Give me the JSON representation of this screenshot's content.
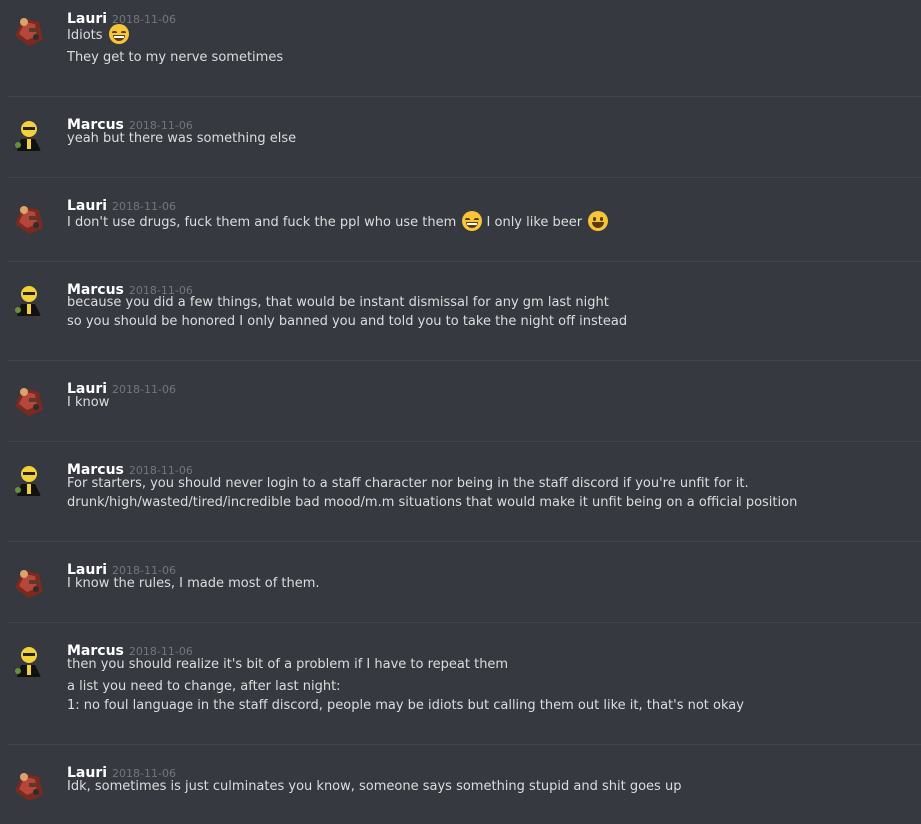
{
  "messages": [
    {
      "author": "Lauri",
      "timestamp": "2018-11-06",
      "avatar": "lauri-avatar",
      "lines": [
        [
          "Idiots ",
          {
            "emoji": "grinning-squint"
          }
        ],
        [
          "They get to my nerve sometimes"
        ]
      ]
    },
    {
      "author": "Marcus",
      "timestamp": "2018-11-06",
      "avatar": "marcus-avatar",
      "lines": [
        [
          "yeah but there was something else"
        ]
      ]
    },
    {
      "author": "Lauri",
      "timestamp": "2018-11-06",
      "avatar": "lauri-avatar",
      "lines": [
        [
          "I don't use drugs, fuck them and fuck the ppl who use them ",
          {
            "emoji": "grinning-squint"
          },
          " I only like beer ",
          {
            "emoji": "smiley"
          }
        ]
      ]
    },
    {
      "author": "Marcus",
      "timestamp": "2018-11-06",
      "avatar": "marcus-avatar",
      "lines": [
        [
          "because you did a few things, that would be instant dismissal for any gm last night"
        ],
        [
          "so you should be honored I only banned you and told you to take the night off instead"
        ]
      ]
    },
    {
      "author": "Lauri",
      "timestamp": "2018-11-06",
      "avatar": "lauri-avatar",
      "lines": [
        [
          "I know"
        ]
      ]
    },
    {
      "author": "Marcus",
      "timestamp": "2018-11-06",
      "avatar": "marcus-avatar",
      "lines": [
        [
          "For starters, you should never login to a staff character nor being in the staff discord if you're unfit for it."
        ],
        [
          "drunk/high/wasted/tired/incredible bad mood/m.m situations that would make it unfit being on a official position"
        ]
      ]
    },
    {
      "author": "Lauri",
      "timestamp": "2018-11-06",
      "avatar": "lauri-avatar",
      "lines": [
        [
          "I know the rules, I made most of them."
        ]
      ]
    },
    {
      "author": "Marcus",
      "timestamp": "2018-11-06",
      "avatar": "marcus-avatar",
      "lines": [
        [
          "then you should realize it's bit of a problem if I have to repeat them"
        ],
        [
          "a list you need to change, after last night:"
        ],
        [
          "1: no foul language in the staff discord, people may be idiots but calling them out like it, that's not okay"
        ]
      ]
    },
    {
      "author": "Lauri",
      "timestamp": "2018-11-06",
      "avatar": "lauri-avatar",
      "lines": [
        [
          "Idk, sometimes is just culminates you know, someone says something stupid and shit goes up"
        ]
      ]
    }
  ]
}
